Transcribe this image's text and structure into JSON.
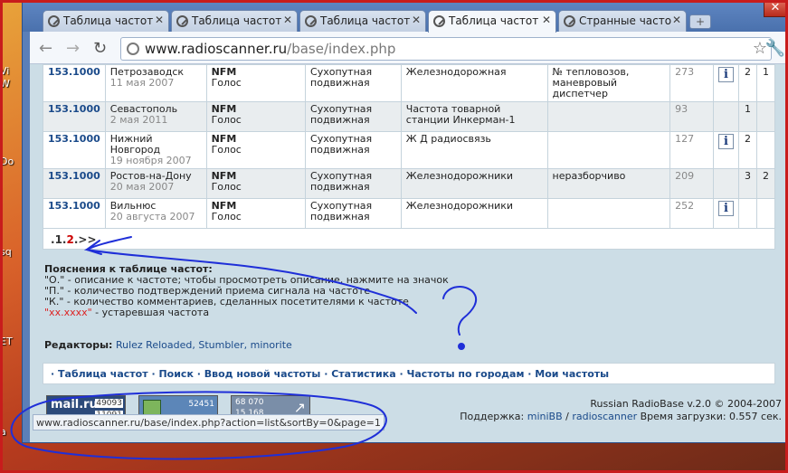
{
  "desktop": {
    "icon_labels": [
      "Vi",
      "W",
      "Do",
      "sq",
      "ET",
      "a"
    ]
  },
  "tabs": [
    {
      "label": "Таблица частот",
      "active": false
    },
    {
      "label": "Таблица частот",
      "active": false
    },
    {
      "label": "Таблица частот",
      "active": false
    },
    {
      "label": "Таблица частот",
      "active": true
    },
    {
      "label": "Странные часто",
      "active": false
    }
  ],
  "toolbar": {
    "url_host": "www.radioscanner.ru",
    "url_path": "/base/index.php"
  },
  "table": {
    "rows": [
      {
        "freq": "153.1000",
        "city": "Петрозаводск",
        "date": "11 мая 2007",
        "mod": "NFM",
        "mod_sub": "Голос",
        "service": "Сухопутная подвижная",
        "desc": "Железнодорожная",
        "note": "№ тепловозов, маневровый диспетчер",
        "count": "273",
        "info": true,
        "p": "2",
        "k": "1"
      },
      {
        "freq": "153.1000",
        "city": "Севастополь",
        "date": "2 мая 2011",
        "mod": "NFM",
        "mod_sub": "Голос",
        "service": "Сухопутная подвижная",
        "desc": "Частота товарной станции Инкерман-1",
        "note": "",
        "count": "93",
        "info": false,
        "p": "1",
        "k": ""
      },
      {
        "freq": "153.1000",
        "city": "Нижний Новгород",
        "date": "19 ноября 2007",
        "mod": "NFM",
        "mod_sub": "Голос",
        "service": "Сухопутная подвижная",
        "desc": "Ж Д радиосвязь",
        "note": "",
        "count": "127",
        "info": true,
        "p": "2",
        "k": ""
      },
      {
        "freq": "153.1000",
        "city": "Ростов-на-Дону",
        "date": "20 мая 2007",
        "mod": "NFM",
        "mod_sub": "Голос",
        "service": "Сухопутная подвижная",
        "desc": "Железнодорожники",
        "note": "неразборчиво",
        "count": "209",
        "info": false,
        "p": "3",
        "k": "2"
      },
      {
        "freq": "153.1000",
        "city": "Вильнюс",
        "date": "20 августа 2007",
        "mod": "NFM",
        "mod_sub": "Голос",
        "service": "Сухопутная подвижная",
        "desc": "Железнодорожники",
        "note": "",
        "count": "252",
        "info": true,
        "p": "",
        "k": ""
      }
    ]
  },
  "pager": {
    "pre": ".",
    "p1": "1",
    "sep": ".",
    "p2": "2",
    "next": ".>>"
  },
  "legend": {
    "title": "Пояснения к таблице частот:",
    "line_o": "\"О.\" - описание к частоте; чтобы просмотреть описание, нажмите на значок",
    "line_p": "\"П.\" - количество подтверждений приема сигнала на частоте",
    "line_k": "\"К.\" - количество комментариев, сделанных посетителями к частоте",
    "old_sample": "\"xx.xxxx\"",
    "old_text": " - устаревшая частота"
  },
  "editors": {
    "label": "Редакторы:",
    "names": "Rulez Reloaded, Stumbler, minorite"
  },
  "bottom_nav": {
    "items": [
      "Таблица частот",
      "Поиск",
      "Ввод новой частоты",
      "Статистика",
      "Частоты по городам",
      "Мои частоты"
    ]
  },
  "counters": {
    "mailru_logo": "mail.ru",
    "mailru_n1": "49093",
    "mailru_n2": "11091",
    "c2": "52451",
    "c3a": "68 070",
    "c3b": "15 168"
  },
  "footer": {
    "line1": "Russian RadioBase v.2.0 © 2004-2007",
    "support_label": "Поддержка:",
    "support_link1": "miniBB",
    "support_sep": " / ",
    "support_link2": "radioscanner",
    "load_time": "Время загрузки: 0.557 сек."
  },
  "statusbar": {
    "text": "www.radioscanner.ru/base/index.php?action=list&sortBy=0&page=1"
  },
  "colors": {
    "annotation": "#1f2fd8",
    "frame": "#c81c1c",
    "link": "#1a4a8a",
    "obsolete": "#d22"
  }
}
